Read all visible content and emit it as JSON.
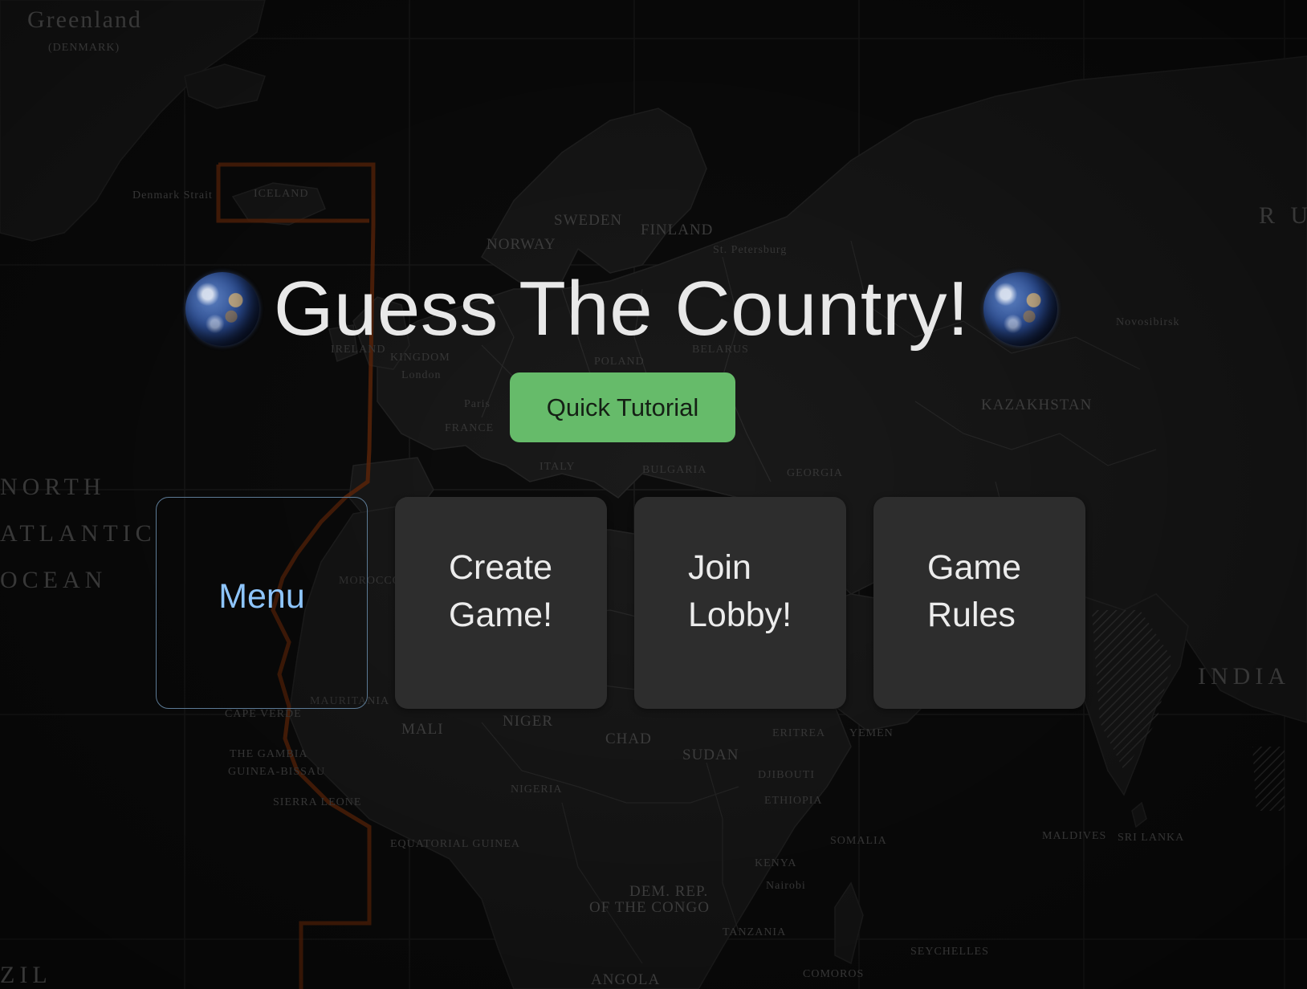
{
  "page": {
    "title": "Guess The Country!",
    "title_icon": "earth-globe-icon"
  },
  "background": {
    "type": "dark world map",
    "labels": {
      "greenland": "Greenland",
      "denmark": "(DENMARK)",
      "iceland": "ICELAND",
      "denmark_strait": "Denmark Strait",
      "sweden": "SWEDEN",
      "finland": "FINLAND",
      "norway": "NORWAY",
      "st_petersburg": "St. Petersburg",
      "ireland": "IRELAND",
      "kingdom": "KINGDOM",
      "london": "London",
      "poland": "POLAND",
      "belarus": "BELARUS",
      "paris": "Paris",
      "france": "FRANCE",
      "italy": "ITALY",
      "bulgaria": "BULGARIA",
      "georgia": "GEORGIA",
      "kazakhstan": "KAZAKHSTAN",
      "novosibirsk": "Novosibirsk",
      "north": "NORTH",
      "atlantic": "ATLANTIC",
      "ocean": "OCEAN",
      "morocco": "MOROCCO",
      "mauritania": "MAURITANIA",
      "mali": "MALI",
      "niger": "NIGER",
      "chad": "CHAD",
      "sudan": "SUDAN",
      "nigeria": "NIGERIA",
      "ethiopia": "ETHIOPIA",
      "djibouti": "DJIBOUTI",
      "eritrea": "ERITREA",
      "yemen": "YEMEN",
      "somalia": "SOMALIA",
      "kenya": "KENYA",
      "nairobi": "Nairobi",
      "tanzania": "TANZANIA",
      "angola": "ANGOLA",
      "dem_rep": "DEM. REP.",
      "of_the_congo": "OF THE CONGO",
      "india": "INDIA",
      "sri_lanka": "SRI LANKA",
      "maldives": "MALDIVES",
      "seychelles": "SEYCHELLES",
      "comoros": "COMOROS",
      "cape_verde": "CAPE VERDE",
      "the_gambia": "THE GAMBIA",
      "guinea_bissau": "GUINEA-BISSAU",
      "sierra_leone": "SIERRA LEONE",
      "equatorial_guinea": "EQUATORIAL GUINEA",
      "brazil_fragment": "ZIL",
      "russia_fragment": "R U"
    }
  },
  "tutorial_button": {
    "label": "Quick Tutorial",
    "color": "#66bb6a"
  },
  "menu": {
    "items": [
      {
        "label": "Menu",
        "style": "outlined",
        "text_color": "#8ec5fc"
      },
      {
        "label": "Create Game!",
        "style": "filled"
      },
      {
        "label": "Join Lobby!",
        "style": "filled"
      },
      {
        "label": "Game Rules",
        "style": "filled"
      }
    ]
  },
  "colors": {
    "card_bg": "#2d2d2d",
    "title_text": "#e8e8e8",
    "menu_border": "#5c7a95",
    "antimeridian_line": "#7a2e0a"
  }
}
